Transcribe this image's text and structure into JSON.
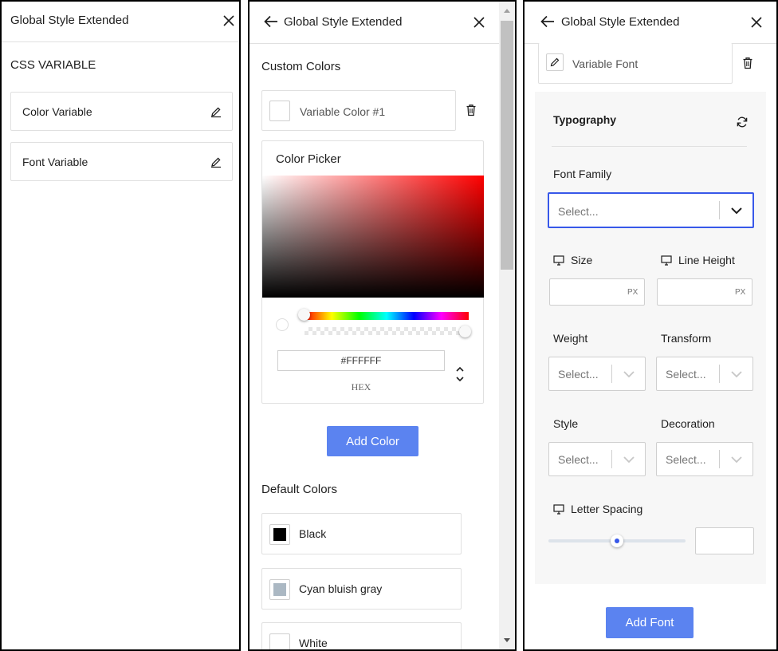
{
  "panel1": {
    "title": "Global Style Extended",
    "section": "CSS VARIABLE",
    "items": [
      {
        "label": "Color Variable"
      },
      {
        "label": "Font Variable"
      }
    ]
  },
  "panel2": {
    "title": "Global Style Extended",
    "custom_colors_title": "Custom Colors",
    "variable_color_label": "Variable Color #1",
    "picker_title": "Color Picker",
    "hex_value": "#FFFFFF",
    "hex_label": "HEX",
    "add_color_label": "Add Color",
    "default_colors_title": "Default Colors",
    "default_colors": [
      {
        "label": "Black",
        "color": "#000000"
      },
      {
        "label": "Cyan bluish gray",
        "color": "#abb8c3"
      },
      {
        "label": "White",
        "color": "#ffffff"
      }
    ]
  },
  "panel3": {
    "title": "Global Style Extended",
    "variable_font_label": "Variable Font",
    "typography_title": "Typography",
    "font_family_label": "Font Family",
    "font_family_placeholder": "Select...",
    "size_label": "Size",
    "line_height_label": "Line Height",
    "unit": "PX",
    "weight_label": "Weight",
    "transform_label": "Transform",
    "style_label": "Style",
    "decoration_label": "Decoration",
    "select_placeholder": "Select...",
    "letter_spacing_label": "Letter Spacing",
    "letter_spacing_level": 0.5,
    "add_font_label": "Add Font"
  },
  "colors": {
    "accent": "#5b83f0",
    "focus_border": "#3858e9"
  }
}
